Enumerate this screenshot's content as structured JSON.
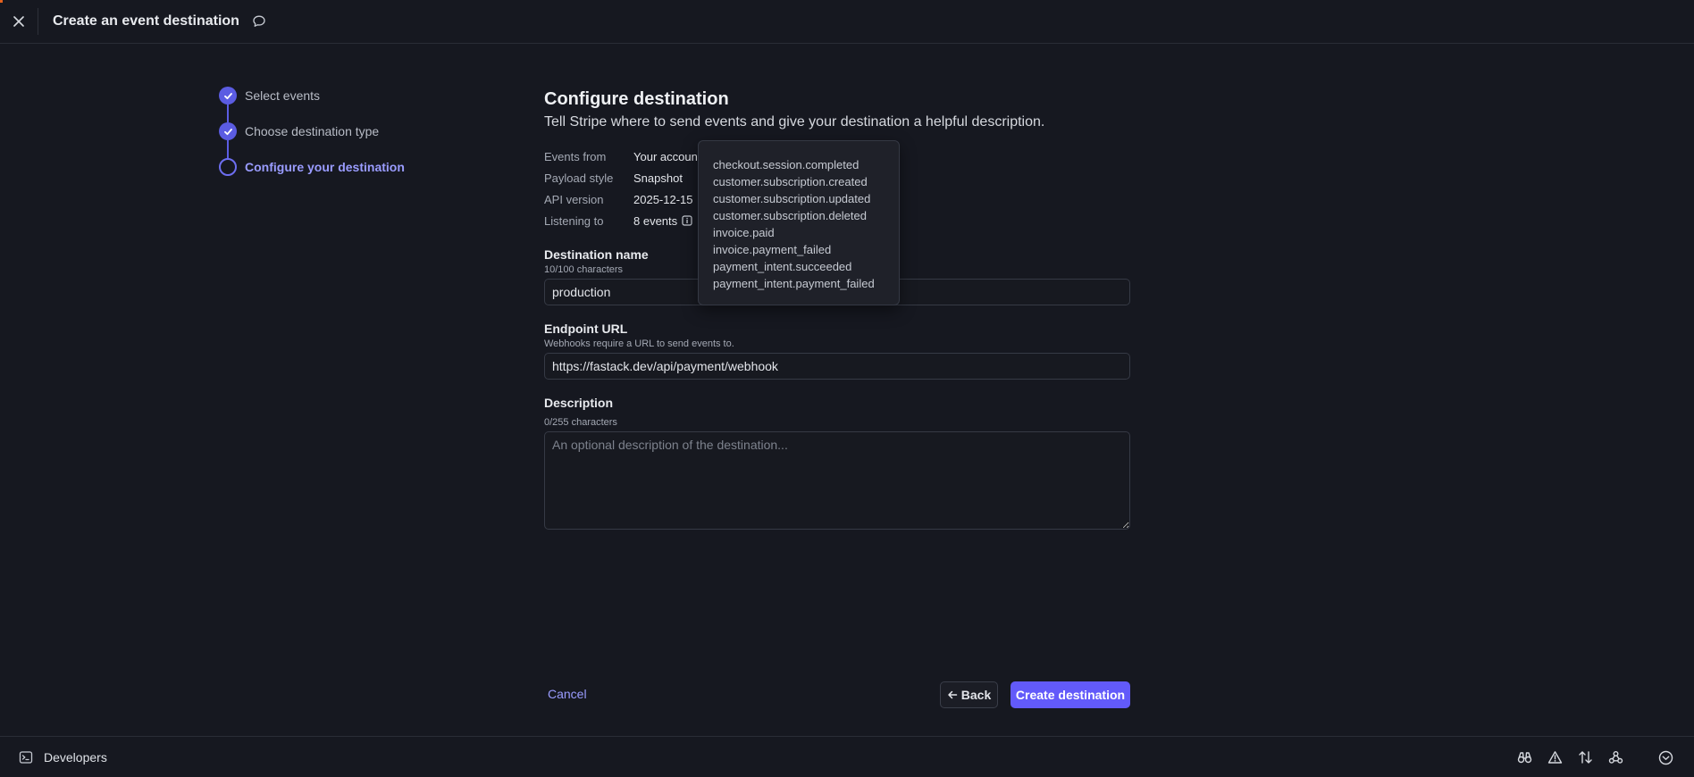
{
  "header": {
    "title": "Create an event destination"
  },
  "stepper": {
    "steps": [
      {
        "label": "Select events",
        "status": "done"
      },
      {
        "label": "Choose destination type",
        "status": "done"
      },
      {
        "label": "Configure your destination",
        "status": "current"
      }
    ]
  },
  "main": {
    "heading": "Configure destination",
    "subheading": "Tell Stripe where to send events and give your destination a helpful description.",
    "meta": [
      {
        "label": "Events from",
        "value": "Your accoun"
      },
      {
        "label": "Payload style",
        "value": "Snapshot"
      },
      {
        "label": "API version",
        "value": "2025-12-15"
      },
      {
        "label": "Listening to",
        "value": "8 events"
      }
    ],
    "destination_name": {
      "label": "Destination name",
      "hint": "10/100 characters",
      "value": "production"
    },
    "endpoint_url": {
      "label": "Endpoint URL",
      "hint": "Webhooks require a URL to send events to.",
      "value": "https://fastack.dev/api/payment/webhook"
    },
    "description": {
      "label": "Description",
      "hint": "0/255 characters",
      "placeholder": "An optional description of the destination...",
      "value": ""
    }
  },
  "tooltip": {
    "events": [
      "checkout.session.completed",
      "customer.subscription.created",
      "customer.subscription.updated",
      "customer.subscription.deleted",
      "invoice.paid",
      "invoice.payment_failed",
      "payment_intent.succeeded",
      "payment_intent.payment_failed"
    ]
  },
  "actions": {
    "cancel_label": "Cancel",
    "back_label": "Back",
    "create_label": "Create destination"
  },
  "devbar": {
    "label": "Developers",
    "icons": [
      "binoculars-icon",
      "warning-icon",
      "sort-arrows-icon",
      "webhook-icon",
      "chevron-down-circle-icon"
    ]
  },
  "colors": {
    "background": "#161820",
    "accent": "#625afa",
    "step_accent": "#5b5ce2",
    "link": "#9a9cff"
  }
}
